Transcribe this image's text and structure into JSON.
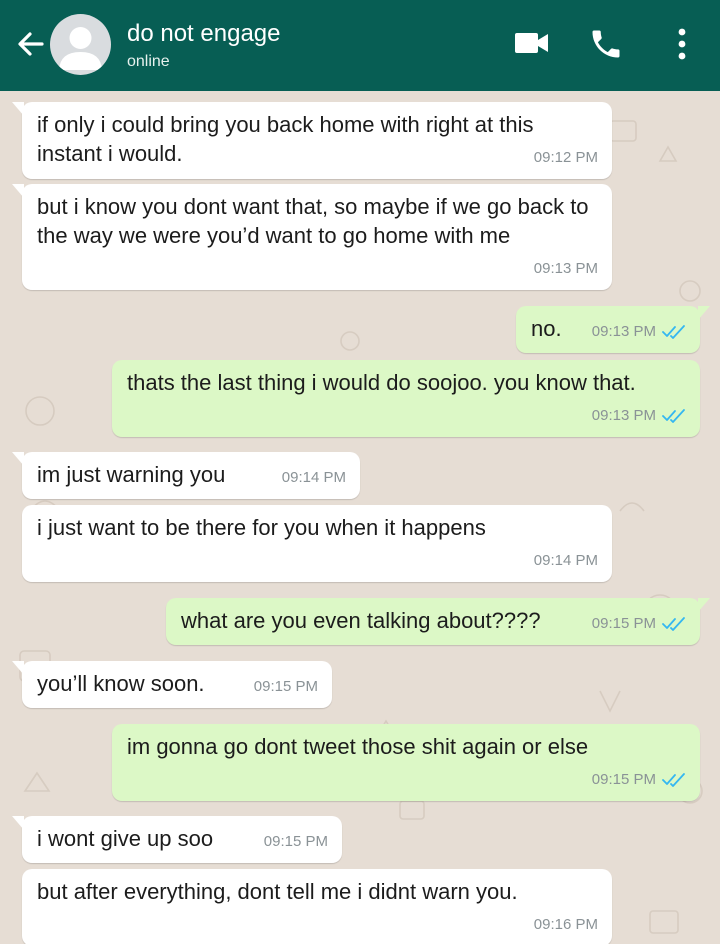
{
  "header": {
    "contact_name": "do not engage",
    "status": "online",
    "color": "#075e54",
    "icons": [
      "arrow-left-icon",
      "avatar-placeholder",
      "video-call-icon",
      "phone-icon",
      "more-vert-icon"
    ]
  },
  "chat": {
    "colors": {
      "incoming": "#ffffff",
      "outgoing": "#dcf8c6",
      "read_ticks": "#34b7f1"
    },
    "messages": [
      {
        "direction": "in",
        "text": "if only i could bring you back home with right at this instant i would.",
        "time": "09:12 PM"
      },
      {
        "direction": "in",
        "text": "but i know you dont want that, so maybe if we go back to the way we were you’d want to go home with me",
        "time": "09:13 PM"
      },
      {
        "direction": "out",
        "text": "no.",
        "time": "09:13 PM",
        "status": "read"
      },
      {
        "direction": "out",
        "text": "thats the last thing i would do soojoo. you know that.",
        "time": "09:13 PM",
        "status": "read"
      },
      {
        "direction": "in",
        "text": "im just warning you",
        "time": "09:14 PM"
      },
      {
        "direction": "in",
        "text": "i just want to be there for you when it happens",
        "time": "09:14 PM"
      },
      {
        "direction": "out",
        "text": "what are you even talking about????",
        "time": "09:15 PM",
        "status": "read"
      },
      {
        "direction": "in",
        "text": "you’ll know soon.",
        "time": "09:15 PM"
      },
      {
        "direction": "out",
        "text": "im gonna go dont tweet those shit again or else",
        "time": "09:15 PM",
        "status": "read"
      },
      {
        "direction": "in",
        "text": "i wont give up soo",
        "time": "09:15 PM"
      },
      {
        "direction": "in",
        "text": "but after everything, dont tell me i didnt warn you.",
        "time": "09:16 PM"
      }
    ]
  }
}
